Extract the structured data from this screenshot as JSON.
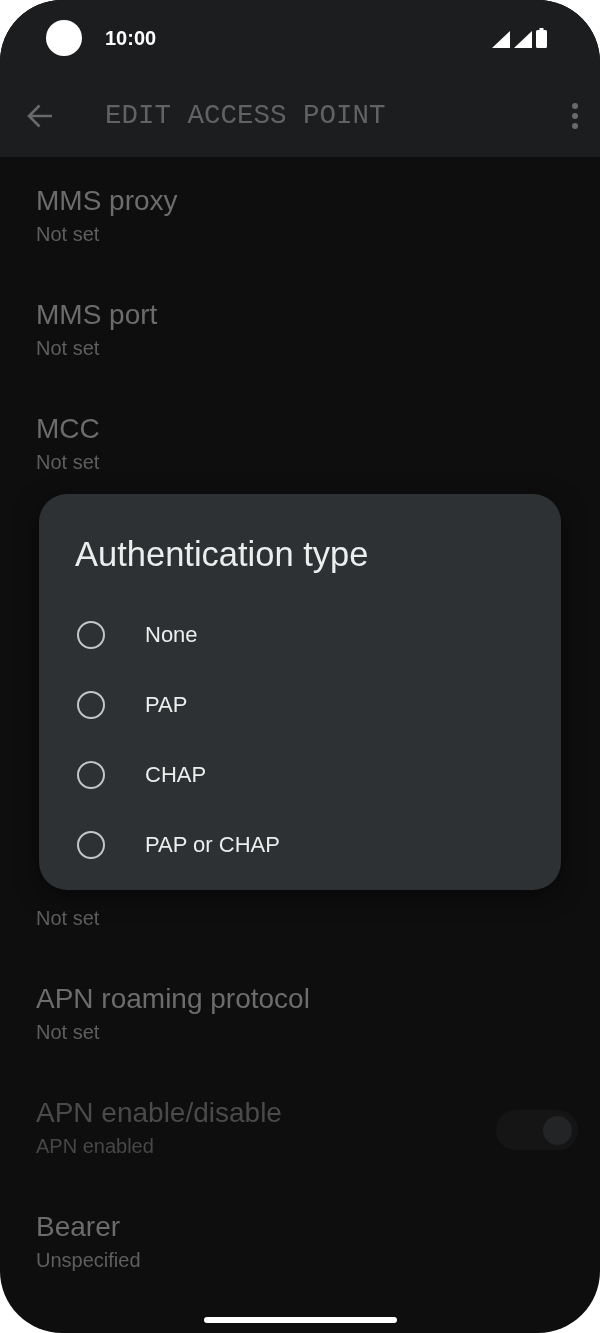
{
  "status_bar": {
    "time": "10:00"
  },
  "toolbar": {
    "title": "EDIT ACCESS POINT"
  },
  "settings_above": [
    {
      "kind": "text",
      "title": "MMS proxy",
      "summary": "Not set",
      "disabled": false
    },
    {
      "kind": "text",
      "title": "MMS port",
      "summary": "Not set",
      "disabled": false
    },
    {
      "kind": "text",
      "title": "MCC",
      "summary": "Not set",
      "disabled": false
    }
  ],
  "settings_below": [
    {
      "kind": "text",
      "summary": "Not set",
      "disabled": false
    },
    {
      "kind": "text",
      "title": "APN roaming protocol",
      "summary": "Not set",
      "disabled": false
    },
    {
      "kind": "switch",
      "title": "APN enable/disable",
      "summary": "APN enabled",
      "disabled": true,
      "on": true
    },
    {
      "kind": "text",
      "title": "Bearer",
      "summary": "Unspecified",
      "disabled": false
    }
  ],
  "dialog": {
    "title": "Authentication type",
    "options": [
      {
        "label": "None",
        "selected": false
      },
      {
        "label": "PAP",
        "selected": false
      },
      {
        "label": "CHAP",
        "selected": false
      },
      {
        "label": "PAP or CHAP",
        "selected": false
      }
    ]
  }
}
